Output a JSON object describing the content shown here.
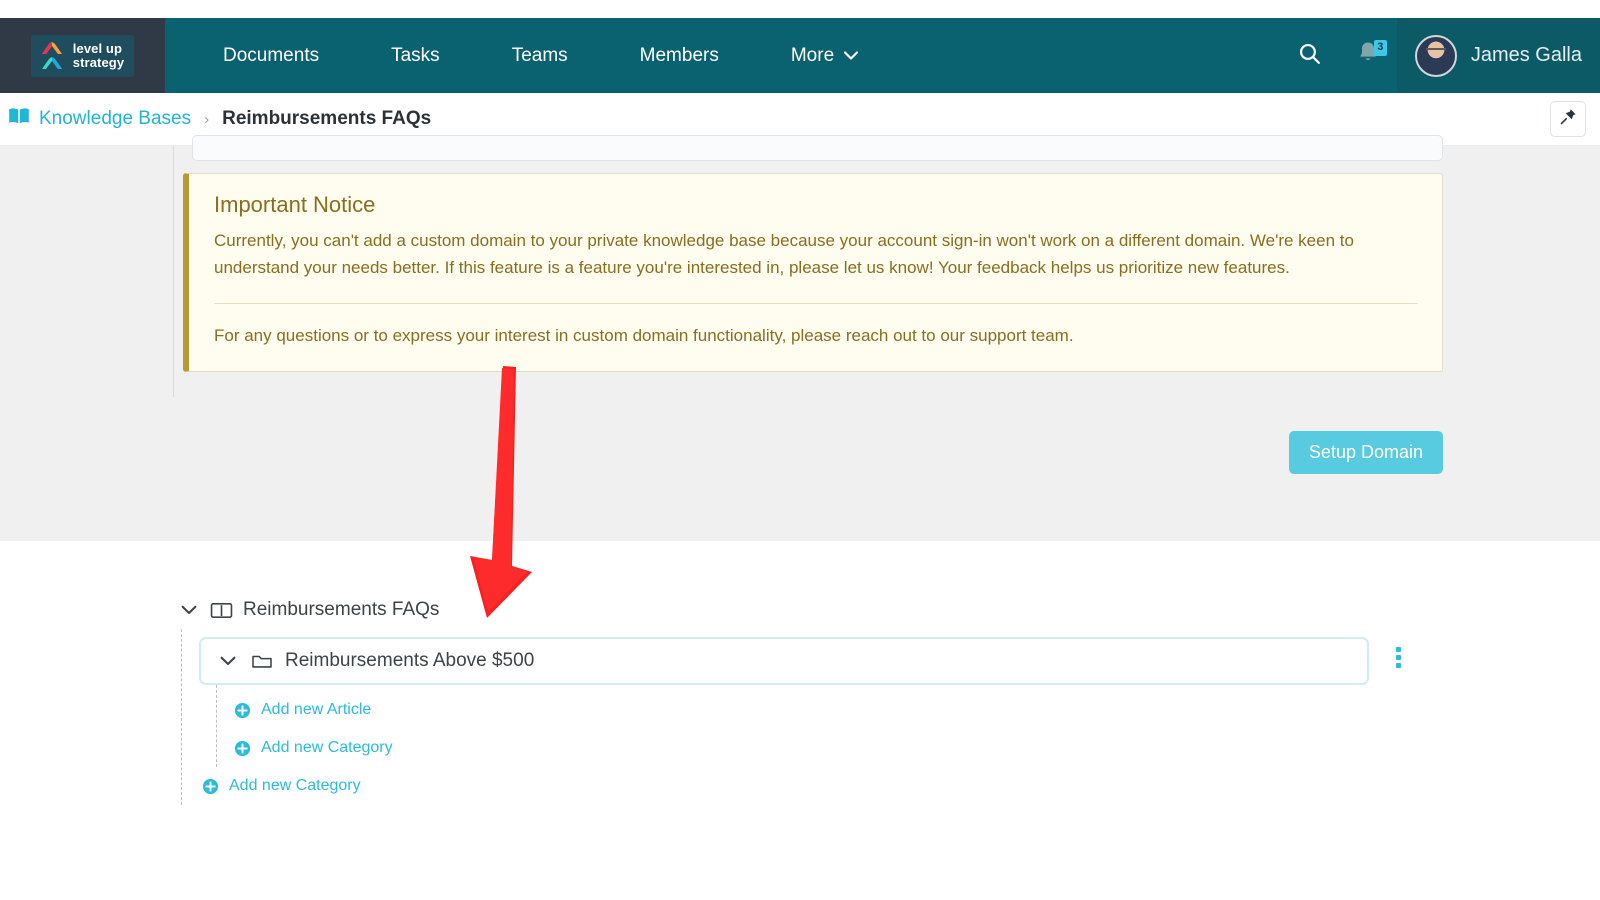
{
  "brand": {
    "logo_line1": "level up",
    "logo_line2": "strategy",
    "logo_icon": "chevrons-logo-icon",
    "nav_bg": "#0a6270",
    "logo_bg": "#2f3a46",
    "accent_cyan": "#29bcdd",
    "button_cyan": "#58cbe0"
  },
  "nav": {
    "items": [
      {
        "label": "Documents"
      },
      {
        "label": "Tasks"
      },
      {
        "label": "Teams"
      },
      {
        "label": "Members"
      },
      {
        "label": "More",
        "caret": "⌄"
      }
    ],
    "search_icon": "search-icon",
    "bell_icon": "bell-icon",
    "notification_count": "3",
    "user_name": "James Galla"
  },
  "breadcrumb": {
    "book_icon": "book-icon",
    "root_label": "Knowledge Bases",
    "separator": "›",
    "current_label": "Reimbursements FAQs",
    "pin_icon": "pin-icon"
  },
  "notice": {
    "title": "Important Notice",
    "paragraph1": "Currently, you can't add a custom domain to your private knowledge base because your account sign-in won't work on a different domain. We're keen to understand your needs better. If this feature is a feature you're interested in, please let us know! Your feedback helps us prioritize new features.",
    "paragraph2": "For any questions or to express your interest in custom domain functionality, please reach out to our support team.",
    "bg_color": "#fffdf0",
    "accent_color": "#b99a33",
    "text_color": "#8a6d1f"
  },
  "actions": {
    "setup_domain_label": "Setup Domain"
  },
  "annotation": {
    "arrow_color": "#fb1f1f",
    "arrow_name": "red-pointer-arrow"
  },
  "tree": {
    "root": {
      "label": "Reimbursements FAQs",
      "icon": "book-open-icon",
      "chevron": "chevron-down-icon",
      "expanded": true
    },
    "category": {
      "label": "Reimbursements Above $500",
      "icon": "folder-icon",
      "chevron": "chevron-down-icon",
      "expanded": true,
      "selected": true,
      "menu_icon": "kebab-menu-icon"
    },
    "category_actions": [
      {
        "label": "Add new Article",
        "icon": "plus-circle-icon"
      },
      {
        "label": "Add new Category",
        "icon": "plus-circle-icon"
      }
    ],
    "root_action": {
      "label": "Add new Category",
      "icon": "plus-circle-icon"
    }
  }
}
